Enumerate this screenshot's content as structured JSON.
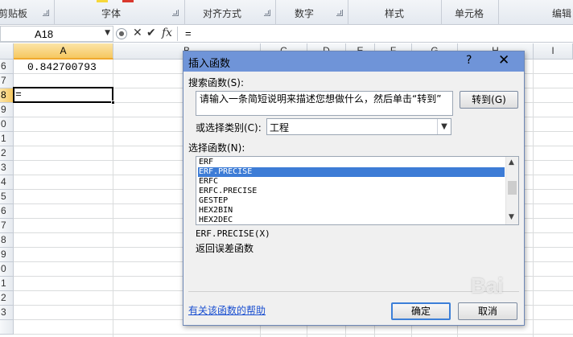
{
  "ribbon": {
    "groups": [
      "剪贴板",
      "字体",
      "对齐方式",
      "数字",
      "样式",
      "单元格",
      "编辑"
    ]
  },
  "formula_bar": {
    "name_box": "A18",
    "content": "=",
    "fx_label": "fx"
  },
  "sheet": {
    "columns": [
      "A",
      "B",
      "C",
      "D",
      "E",
      "F",
      "G",
      "H",
      "I"
    ],
    "rows": [
      "6",
      "7",
      "8",
      "9",
      "0",
      "1",
      "2",
      "3",
      "4",
      "5",
      "6",
      "7",
      "8",
      "9",
      "0",
      "1",
      "2",
      "3"
    ],
    "cell_a6": "0.842700793",
    "active_value": "="
  },
  "dialog": {
    "title": "插入函数",
    "help_glyph": "?",
    "close_glyph": "✕",
    "search_label": "搜索函数(S):",
    "search_text": "请输入一条简短说明来描述您想做什么，然后单击“转到”",
    "go_button": "转到(G)",
    "category_label": "或选择类别(C):",
    "category_value": "工程",
    "select_label": "选择函数(N):",
    "functions": [
      "ERF",
      "ERF.PRECISE",
      "ERFC",
      "ERFC.PRECISE",
      "GESTEP",
      "HEX2BIN",
      "HEX2DEC"
    ],
    "selected_function": "ERF.PRECISE",
    "signature": "ERF.PRECISE(X)",
    "description": "返回误差函数",
    "help_link": "有关该函数的帮助",
    "ok_button": "确定",
    "cancel_button": "取消"
  },
  "watermark": "Bai"
}
